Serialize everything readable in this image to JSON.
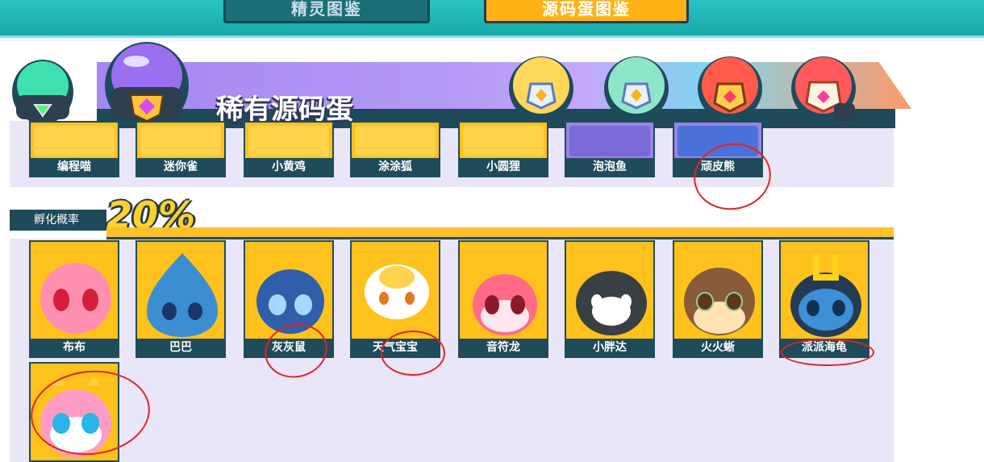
{
  "tabs": {
    "sprite": "精灵图鉴",
    "egg": "源码蛋图鉴"
  },
  "section": {
    "title": "稀有源码蛋"
  },
  "rate": {
    "label": "孵化概率",
    "percent": "20%"
  },
  "top_row": [
    {
      "name": "编程喵"
    },
    {
      "name": "迷你雀"
    },
    {
      "name": "小黄鸡"
    },
    {
      "name": "涂涂狐"
    },
    {
      "name": "小圆狸"
    },
    {
      "name": "泡泡鱼"
    },
    {
      "name": "顽皮熊"
    }
  ],
  "mid_row": [
    {
      "name": "布布",
      "color": "#ff86a9"
    },
    {
      "name": "巴巴",
      "color": "#3b8ed2"
    },
    {
      "name": "灰灰鼠",
      "color": "#2f5fa8"
    },
    {
      "name": "天气宝宝",
      "color": "#ffffff"
    },
    {
      "name": "音符龙",
      "color": "#ff6a86"
    },
    {
      "name": "小胖达",
      "color": "#3a3e45"
    },
    {
      "name": "火火蜥",
      "color": "#8a5b39"
    },
    {
      "name": "派派海龟",
      "color": "#3d8fd8"
    }
  ],
  "bottom_row": [
    {
      "name": "",
      "color": "#ff9cc6"
    }
  ],
  "colors": {
    "accent": "#ffc21c",
    "dark": "#1f4b5b",
    "purple": "#a487f2",
    "teal": "#1aa9aa"
  }
}
